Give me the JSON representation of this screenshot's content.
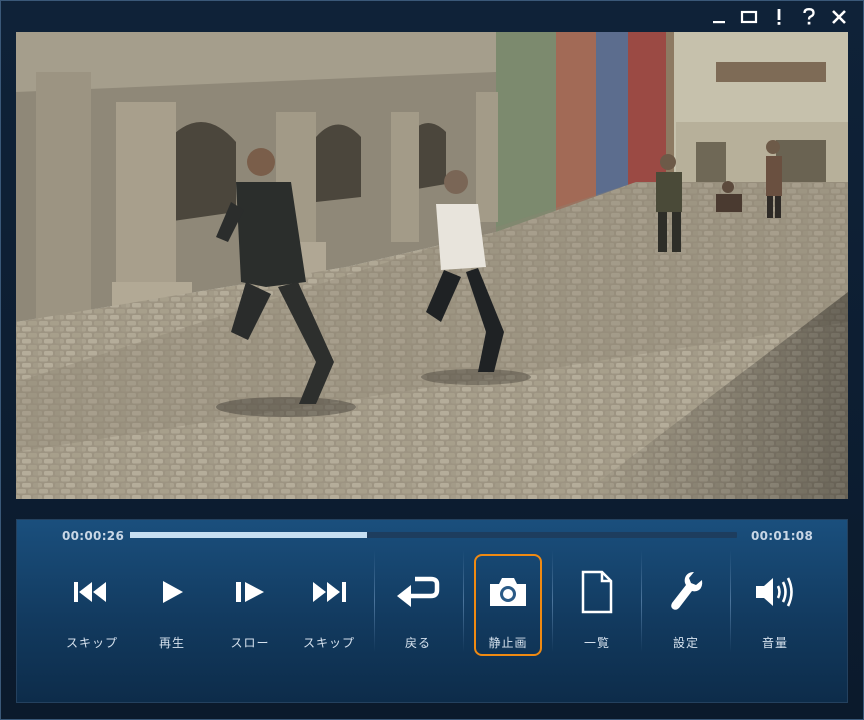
{
  "window": {
    "buttons": [
      {
        "name": "minimize",
        "glyph": "_"
      },
      {
        "name": "maximize",
        "glyph": "□"
      },
      {
        "name": "info",
        "glyph": "!"
      },
      {
        "name": "help",
        "glyph": "?"
      },
      {
        "name": "close",
        "glyph": "✕"
      }
    ]
  },
  "player": {
    "current_time": "00:00:26",
    "total_time": "00:01:08",
    "progress": 0.39,
    "controls": [
      {
        "id": "skip-back",
        "icon": "skip-back-icon",
        "label": "スキップ"
      },
      {
        "id": "play",
        "icon": "play-icon",
        "label": "再生"
      },
      {
        "id": "slow",
        "icon": "slow-play-icon",
        "label": "スロー"
      },
      {
        "id": "skip-forward",
        "icon": "skip-forward-icon",
        "label": "スキップ"
      },
      {
        "id": "back",
        "icon": "return-arrow-icon",
        "label": "戻る"
      },
      {
        "id": "snapshot",
        "icon": "camera-icon",
        "label": "静止画"
      },
      {
        "id": "list",
        "icon": "document-icon",
        "label": "一覧"
      },
      {
        "id": "settings",
        "icon": "wrench-icon",
        "label": "設定"
      },
      {
        "id": "volume",
        "icon": "speaker-icon",
        "label": "音量"
      }
    ],
    "highlight_color": "#f08a12",
    "accent_color": "#c6dff2"
  }
}
